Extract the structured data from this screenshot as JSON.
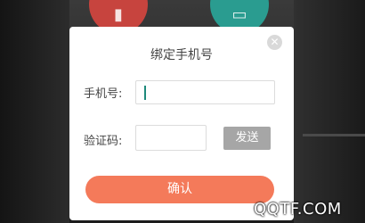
{
  "dialog": {
    "title": "绑定手机号",
    "close_icon": "close-icon",
    "phone_label": "手机号:",
    "phone_value": "",
    "code_label": "验证码:",
    "code_value": "",
    "send_label": "发送",
    "confirm_label": "确认"
  },
  "colors": {
    "confirm_button": "#f47a5a",
    "send_button": "#a6a6a6",
    "caret": "#1e8a7c",
    "background_icon_red": "#c7443e",
    "background_icon_teal": "#2a9c90"
  },
  "background": {
    "icons": [
      "microphone-icon",
      "tv-icon"
    ]
  },
  "watermark": "QQTF.COM"
}
